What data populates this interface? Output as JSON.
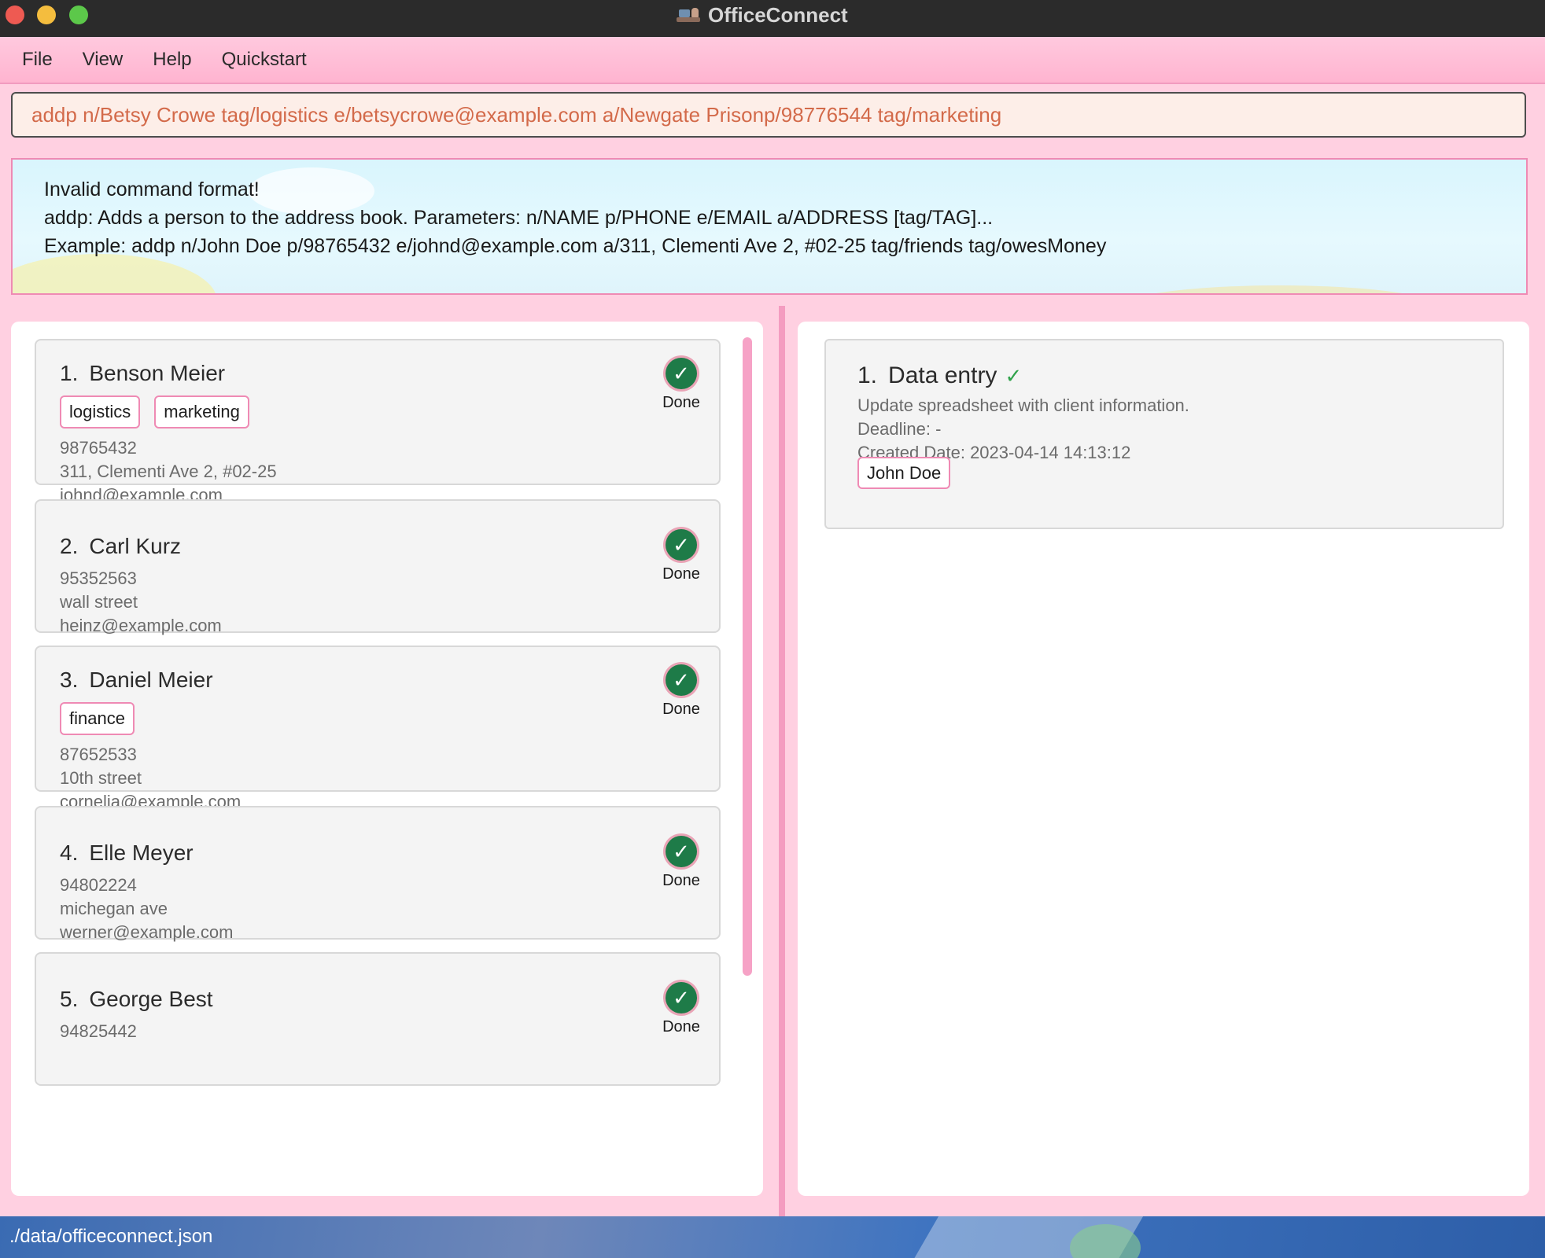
{
  "window": {
    "title": "OfficeConnect"
  },
  "menu": {
    "items": [
      "File",
      "View",
      "Help",
      "Quickstart"
    ]
  },
  "command": {
    "value": "addp n/Betsy Crowe tag/logistics e/betsycrowe@example.com a/Newgate Prisonp/98776544 tag/marketing"
  },
  "result": {
    "lines": [
      "Invalid command format!",
      "addp: Adds a person to the address book. Parameters: n/NAME p/PHONE e/EMAIL a/ADDRESS [tag/TAG]...",
      "Example: addp n/John Doe p/98765432 e/johnd@example.com a/311, Clementi Ave 2, #02-25 tag/friends tag/owesMoney"
    ]
  },
  "persons": [
    {
      "index": "1.",
      "name": "Benson Meier",
      "tags": [
        "logistics",
        "marketing"
      ],
      "phone": "98765432",
      "address": "311, Clementi Ave 2, #02-25",
      "email": "johnd@example.com",
      "status": "Done"
    },
    {
      "index": "2.",
      "name": "Carl Kurz",
      "tags": [],
      "phone": "95352563",
      "address": "wall street",
      "email": "heinz@example.com",
      "status": "Done"
    },
    {
      "index": "3.",
      "name": "Daniel Meier",
      "tags": [
        "finance"
      ],
      "phone": "87652533",
      "address": "10th street",
      "email": "cornelia@example.com",
      "status": "Done"
    },
    {
      "index": "4.",
      "name": "Elle Meyer",
      "tags": [],
      "phone": "94802224",
      "address": "michegan ave",
      "email": "werner@example.com",
      "status": "Done"
    },
    {
      "index": "5.",
      "name": "George Best",
      "tags": [],
      "phone": "94825442",
      "status": "Done"
    }
  ],
  "tasks": [
    {
      "index": "1.",
      "title": "Data entry",
      "check": "✓",
      "description": "Update spreadsheet with client information.",
      "deadline": "Deadline: -",
      "created": "Created Date: 2023-04-14 14:13:12",
      "assignee": "John Doe"
    }
  ],
  "status_bar": {
    "path": "./data/officeconnect.json"
  },
  "colors": {
    "accent_pink": "#ef8ab4",
    "done_green": "#1e7b48",
    "command_text": "#d36a4a"
  },
  "icons": {
    "done": "check-circle-icon",
    "task_done": "checkmark-icon",
    "app": "office-desk-icon"
  }
}
